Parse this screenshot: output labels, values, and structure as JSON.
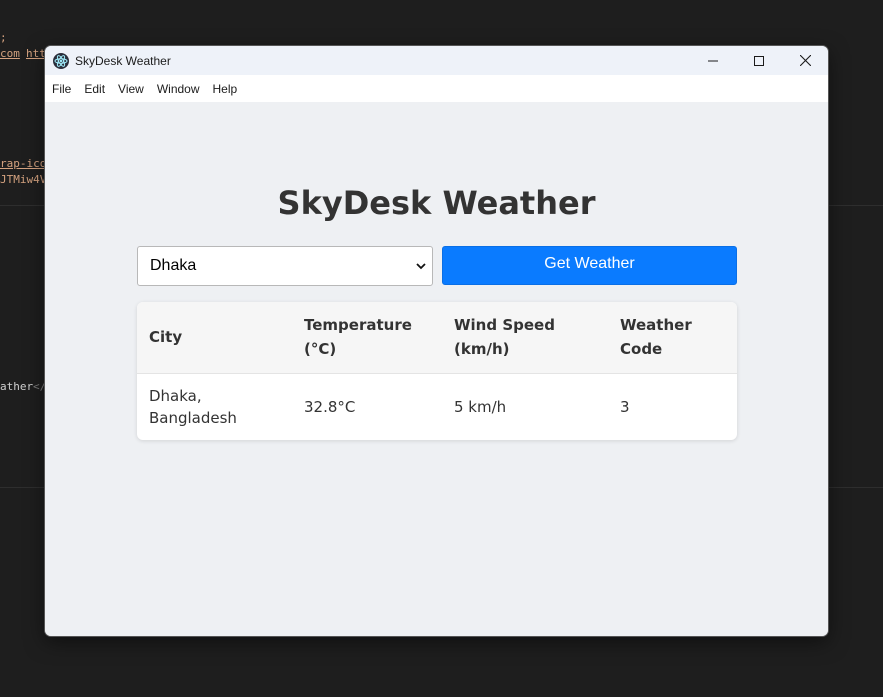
{
  "background_code": {
    "line1": ";",
    "line2a": "com",
    "line2b": "htt",
    "line3": "rap-ico",
    "line4": "JTMiw4V",
    "line5a": "ather",
    "line5b": "</"
  },
  "window": {
    "title": "SkyDesk Weather",
    "controls": [
      "minimize",
      "maximize",
      "close"
    ]
  },
  "menu": {
    "items": [
      "File",
      "Edit",
      "View",
      "Window",
      "Help"
    ]
  },
  "app": {
    "heading": "SkyDesk Weather",
    "city_select": {
      "selected": "Dhaka"
    },
    "get_button_label": "Get Weather"
  },
  "table": {
    "headers": [
      "City",
      "Temperature (°C)",
      "Wind Speed (km/h)",
      "Weather Code"
    ],
    "rows": [
      {
        "city": "Dhaka, Bangladesh",
        "temperature": "32.8°C",
        "wind_speed": "5 km/h",
        "weather_code": "3"
      }
    ]
  },
  "colors": {
    "accent": "#0a7bff",
    "window_bg": "#eef0f3",
    "desktop_bg": "#1e1e1e"
  }
}
